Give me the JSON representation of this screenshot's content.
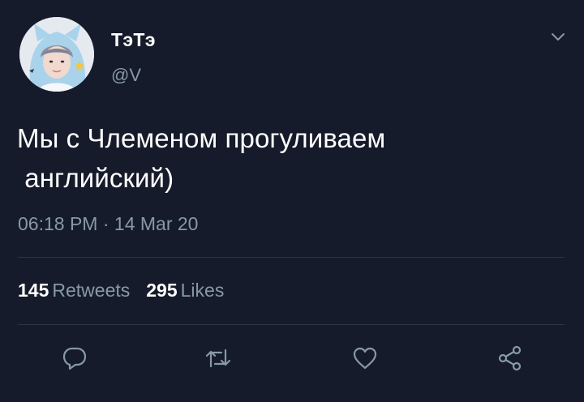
{
  "author": {
    "display_name": "ТэТэ",
    "handle": "@V",
    "avatar_icon": "profile-photo"
  },
  "tweet": {
    "text_lines": [
      "Мы с Члеменом прогуливаем",
      " английский)"
    ],
    "time": "06:18 PM",
    "separator": " · ",
    "date": "14 Mar 20"
  },
  "stats": {
    "retweets_count": "145",
    "retweets_label": "Retweets",
    "likes_count": "295",
    "likes_label": "Likes"
  },
  "actions": [
    {
      "name": "reply",
      "icon": "reply-icon"
    },
    {
      "name": "retweet",
      "icon": "retweet-icon"
    },
    {
      "name": "like",
      "icon": "heart-icon"
    },
    {
      "name": "share",
      "icon": "share-icon"
    }
  ],
  "colors": {
    "background": "#151b2a",
    "primary_text": "#ffffff",
    "secondary_text": "#8899a6",
    "divider": "#2b3544"
  }
}
